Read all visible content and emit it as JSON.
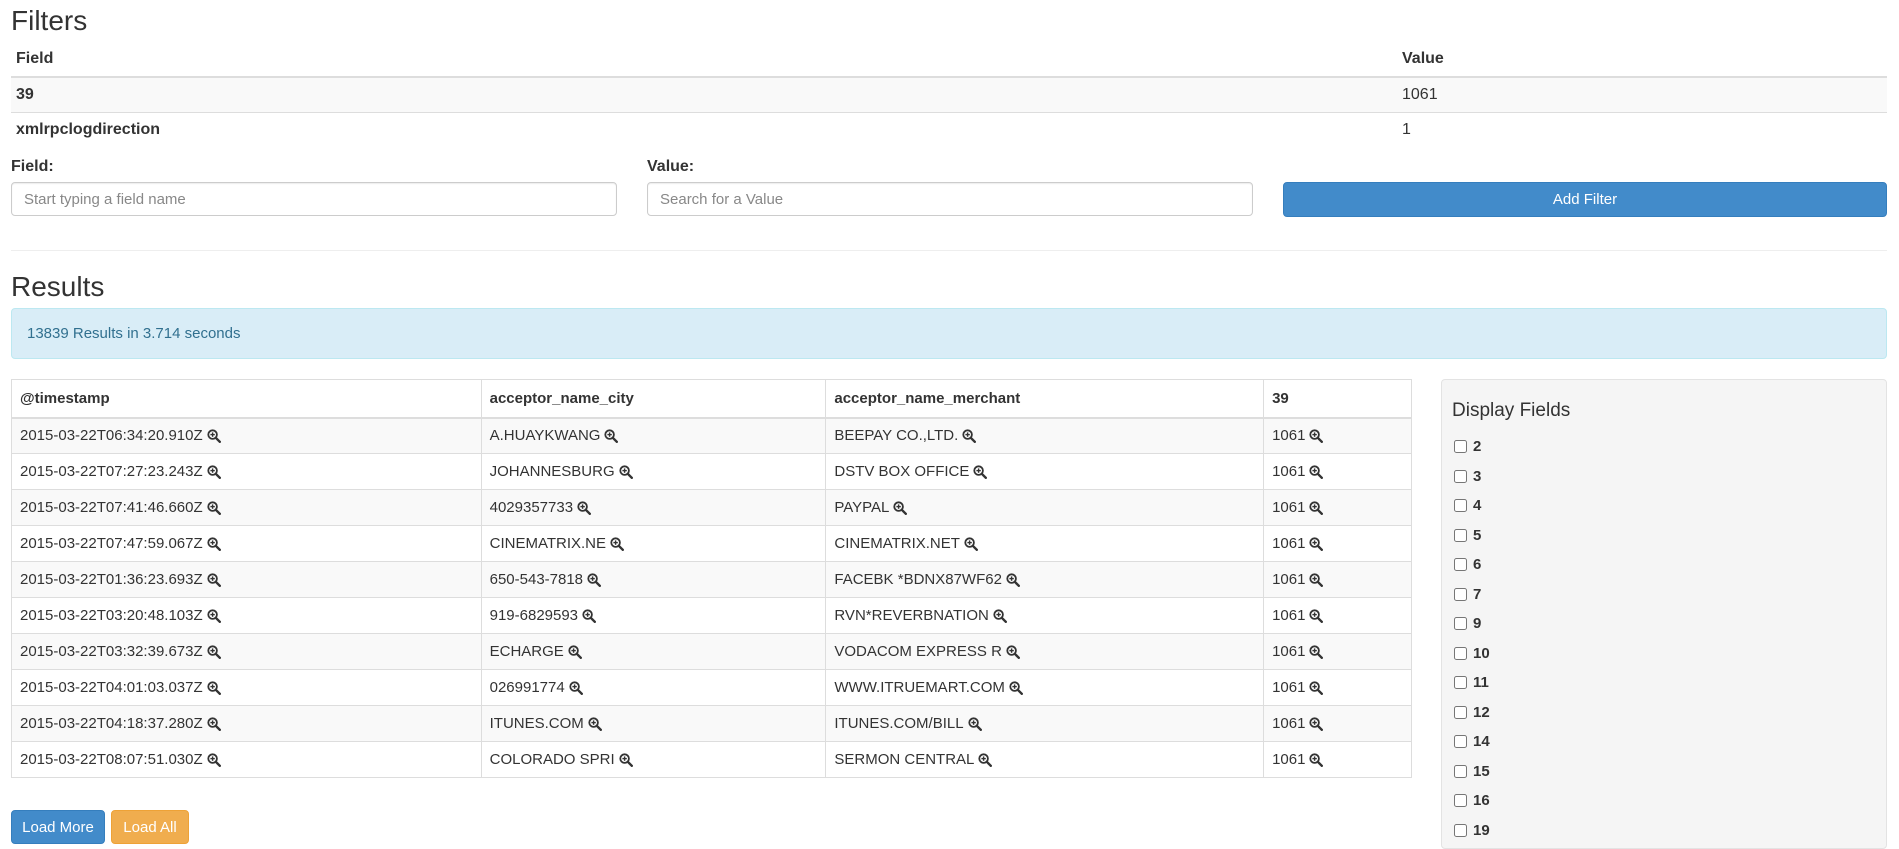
{
  "filters": {
    "title": "Filters",
    "headers": {
      "field": "Field",
      "value": "Value"
    },
    "rows": [
      {
        "field": "39",
        "value": "1061"
      },
      {
        "field": "xmlrpclogdirection",
        "value": "1"
      }
    ],
    "field_label": "Field:",
    "field_placeholder": "Start typing a field name",
    "value_label": "Value:",
    "value_placeholder": "Search for a Value",
    "add_button": "Add Filter"
  },
  "results": {
    "title": "Results",
    "summary": "13839 Results in 3.714 seconds",
    "headers": [
      "@timestamp",
      "acceptor_name_city",
      "acceptor_name_merchant",
      "39"
    ],
    "rows": [
      [
        "2015-03-22T06:34:20.910Z",
        "A.HUAYKWANG",
        "BEEPAY CO.,LTD.",
        "1061"
      ],
      [
        "2015-03-22T07:27:23.243Z",
        "JOHANNESBURG",
        "DSTV BOX OFFICE",
        "1061"
      ],
      [
        "2015-03-22T07:41:46.660Z",
        "4029357733",
        "PAYPAL",
        "1061"
      ],
      [
        "2015-03-22T07:47:59.067Z",
        "CINEMATRIX.NE",
        "CINEMATRIX.NET",
        "1061"
      ],
      [
        "2015-03-22T01:36:23.693Z",
        "650-543-7818",
        "FACEBK *BDNX87WF62",
        "1061"
      ],
      [
        "2015-03-22T03:20:48.103Z",
        "919-6829593",
        "RVN*REVERBNATION",
        "1061"
      ],
      [
        "2015-03-22T03:32:39.673Z",
        "ECHARGE",
        "VODACOM EXPRESS R",
        "1061"
      ],
      [
        "2015-03-22T04:01:03.037Z",
        "026991774",
        "WWW.ITRUEMART.COM",
        "1061"
      ],
      [
        "2015-03-22T04:18:37.280Z",
        "ITUNES.COM",
        "ITUNES.COM/BILL",
        "1061"
      ],
      [
        "2015-03-22T08:07:51.030Z",
        "COLORADO SPRI",
        "SERMON CENTRAL",
        "1061"
      ]
    ],
    "load_more": "Load More",
    "load_all": "Load All"
  },
  "display_fields": {
    "title": "Display Fields",
    "fields": [
      "2",
      "3",
      "4",
      "5",
      "6",
      "7",
      "9",
      "10",
      "11",
      "12",
      "14",
      "15",
      "16",
      "19"
    ]
  },
  "icons": {
    "cell_action": "zoom-in-icon"
  },
  "colors": {
    "primary": "#428bca",
    "warning": "#f0ad4e",
    "info_bg": "#d9edf7",
    "info_text": "#31708f"
  }
}
